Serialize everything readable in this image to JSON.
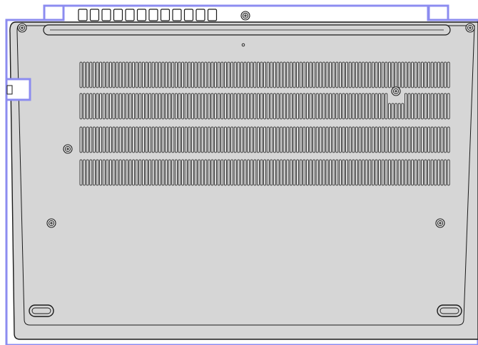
{
  "colors": {
    "chassis_fill": "#d6d6d6",
    "outline": "#1a1a1a",
    "highlight_border": "#8c8cf0",
    "highlight_fill": "#ffffff"
  },
  "figure": {
    "subject": "laptop-bottom-cover",
    "highlighted_regions": 4,
    "rubber_feet": 2,
    "top_vent_slots": 12,
    "vent_rows": 4,
    "screws": 8
  }
}
